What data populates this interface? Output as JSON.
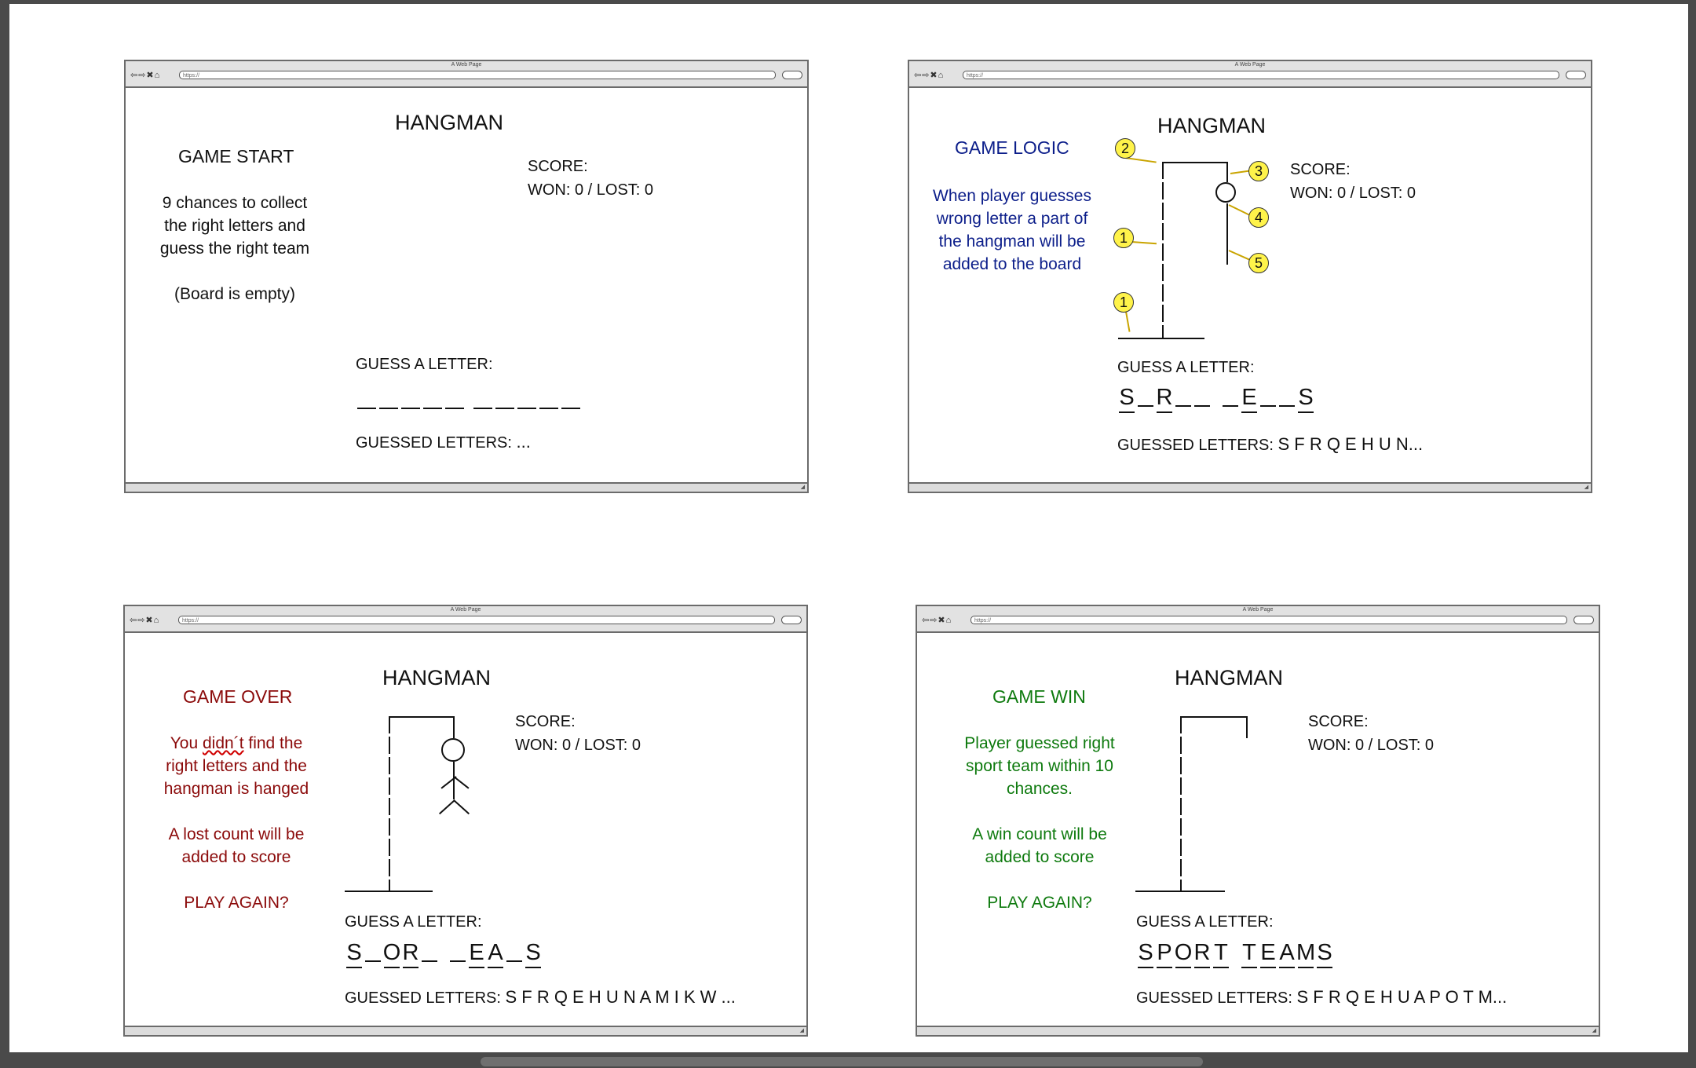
{
  "window": {
    "title": "A Web Page",
    "url": "https://",
    "nav": "⇦⇨✖⌂"
  },
  "app_title": "HANGMAN",
  "score": {
    "label": "SCORE:",
    "value": "WON: 0  / LOST: 0"
  },
  "guess_label": "GUESS A LETTER:",
  "guessed_label": "GUESSED LETTERS:",
  "panels": {
    "start": {
      "heading": "GAME START",
      "lines": [
        "9 chances to collect",
        "the right letters and",
        "guess the right team"
      ],
      "note": "(Board is empty)",
      "word": [
        [
          "",
          "",
          "",
          "",
          ""
        ],
        [
          "",
          "",
          "",
          "",
          ""
        ]
      ],
      "guessed": "..."
    },
    "logic": {
      "heading": "GAME LOGIC",
      "lines": [
        "When player guesses",
        "wrong letter a part of",
        "the hangman will be",
        "added to the board"
      ],
      "badges": [
        "2",
        "3",
        "4",
        "1",
        "5",
        "1"
      ],
      "word": [
        [
          "S",
          "",
          "R",
          "",
          ""
        ],
        [
          "",
          "E",
          "",
          "",
          "S"
        ]
      ],
      "guessed": "S F R Q E H U N..."
    },
    "over": {
      "heading": "GAME OVER",
      "lines_a": [
        "didn´t",
        "right letters and the",
        "hangman is hanged"
      ],
      "line_a_prefix": "You ",
      "line_a_suffix": " find the",
      "lines_b": [
        "A lost count will be",
        "added to score"
      ],
      "play_again": "PLAY AGAIN?",
      "word": [
        [
          "S",
          "",
          "O",
          "R",
          ""
        ],
        [
          "",
          "E",
          "A",
          "",
          "S"
        ]
      ],
      "guessed": "S F R Q E H U N A M I K W ..."
    },
    "win": {
      "heading": "GAME WIN",
      "lines_a": [
        "Player guessed right",
        "sport team within 10",
        "chances."
      ],
      "lines_b": [
        "A win count will be",
        "added to score"
      ],
      "play_again": "PLAY AGAIN?",
      "word": [
        [
          "S",
          "P",
          "O",
          "R",
          "T"
        ],
        [
          "T",
          "E",
          "A",
          "M",
          "S"
        ]
      ],
      "guessed": "S F R Q E H U A P O T M..."
    }
  },
  "colors": {
    "logic": "#0c1e8a",
    "over": "#8b0a0a",
    "win": "#0e7a0e",
    "badge": "#fff34a"
  }
}
